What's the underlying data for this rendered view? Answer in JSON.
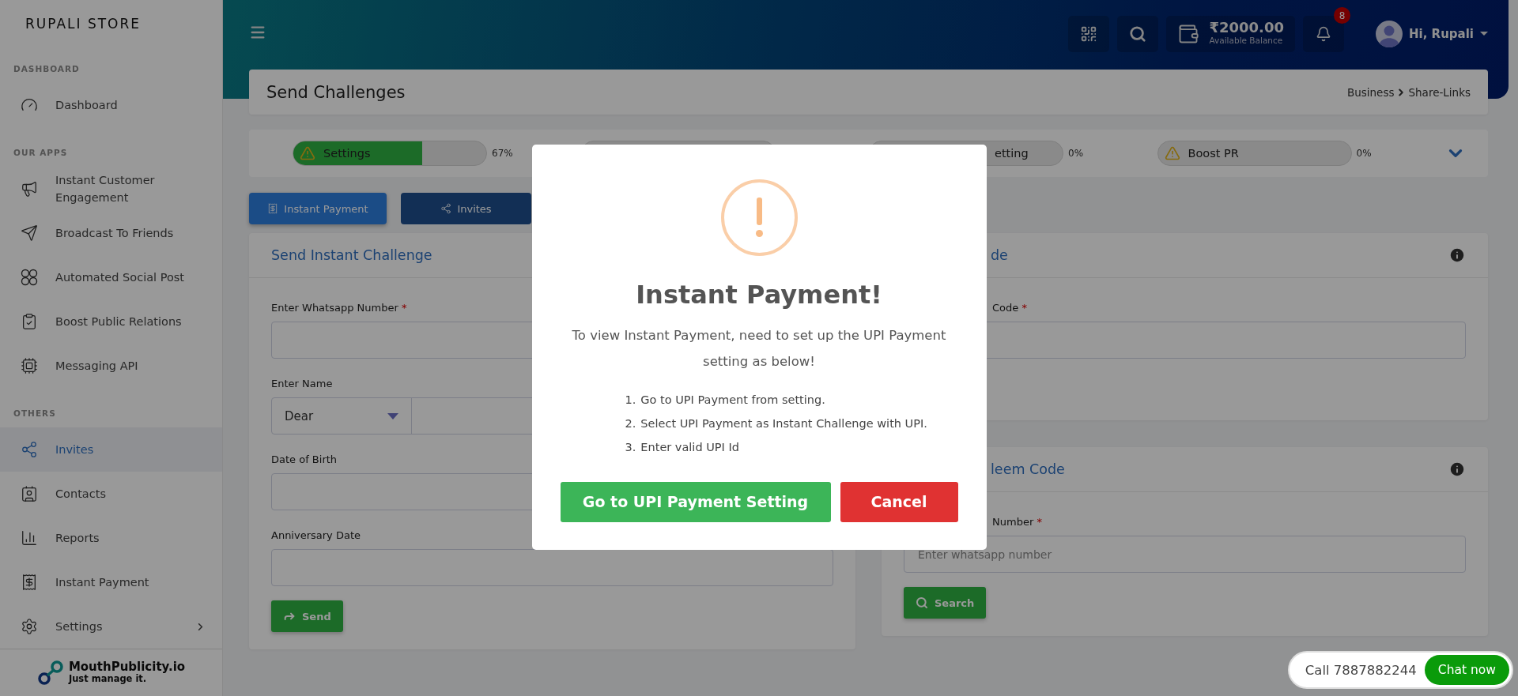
{
  "sidebar": {
    "brand": "RUPALI STORE",
    "sections": [
      {
        "heading": "DASHBOARD",
        "items": [
          {
            "label": "Dashboard",
            "selected": false
          }
        ]
      },
      {
        "heading": "OUR APPS",
        "items": [
          {
            "label": "Instant Customer Engagement",
            "selected": false
          },
          {
            "label": "Broadcast To Friends",
            "selected": false
          },
          {
            "label": "Automated Social Post",
            "selected": false
          },
          {
            "label": "Boost Public Relations",
            "selected": false
          },
          {
            "label": "Messaging API",
            "selected": false
          }
        ]
      },
      {
        "heading": "OTHERS",
        "items": [
          {
            "label": "Invites",
            "selected": true
          },
          {
            "label": "Contacts",
            "selected": false
          },
          {
            "label": "Reports",
            "selected": false
          },
          {
            "label": "Instant Payment",
            "selected": false
          },
          {
            "label": "Settings",
            "selected": false,
            "submenu": true
          }
        ]
      }
    ],
    "footer": {
      "name": "MouthPublicity.io",
      "tagline": "Just manage it."
    }
  },
  "topbar": {
    "balance": "₹2000.00",
    "balance_label": "Available Balance",
    "notification_count": "8",
    "greeting": "Hi, Rupali"
  },
  "page_header": {
    "title": "Send Challenges",
    "breadcrumb": [
      "Business",
      "Share-Links"
    ]
  },
  "progress": [
    {
      "label": "Settings",
      "level": 0.67,
      "reading": "67%",
      "warning": true
    },
    {
      "warning": false
    },
    {
      "label": "etting",
      "reading": "0%",
      "warning": false
    },
    {
      "label": "Boost PR",
      "reading": "0%",
      "warning": true
    }
  ],
  "tabs": [
    {
      "label": "Instant Payment",
      "selected": true
    },
    {
      "label": "Invites",
      "selected": false
    }
  ],
  "left_panel": {
    "title": "Send Instant Challenge",
    "fields": [
      {
        "kind": "text",
        "label": "Enter Whatsapp Number",
        "required_mark": "*"
      },
      {
        "kind": "name",
        "label": "Enter Name",
        "select_value": "Dear"
      },
      {
        "kind": "text",
        "label": "Date of Birth"
      },
      {
        "kind": "text",
        "label": "Anniversary Date"
      }
    ],
    "button": "Send"
  },
  "right_panels": [
    {
      "title": "de",
      "fields": [
        {
          "label": "Code",
          "required_mark": "*"
        }
      ]
    },
    {
      "title": "leem Code",
      "fields": [
        {
          "label": "Number",
          "required_mark": "*",
          "placeholder": "Enter whatsapp number"
        }
      ],
      "button": "Search"
    }
  ],
  "modal": {
    "title": "Instant Payment!",
    "message": "To view Instant Payment, need to set up the UPI Payment setting as below!",
    "steps": [
      {
        "number": "1.",
        "text": "Go to UPI Payment from setting."
      },
      {
        "number": "2.",
        "text": "Select UPI Payment as Instant Challenge with UPI."
      },
      {
        "number": "3.",
        "text": "Enter valid UPI Id"
      }
    ],
    "confirm": "Go to UPI Payment Setting",
    "cancel": "Cancel"
  },
  "chat_widget": {
    "call": "Call 7887882244",
    "button": "Chat now"
  }
}
